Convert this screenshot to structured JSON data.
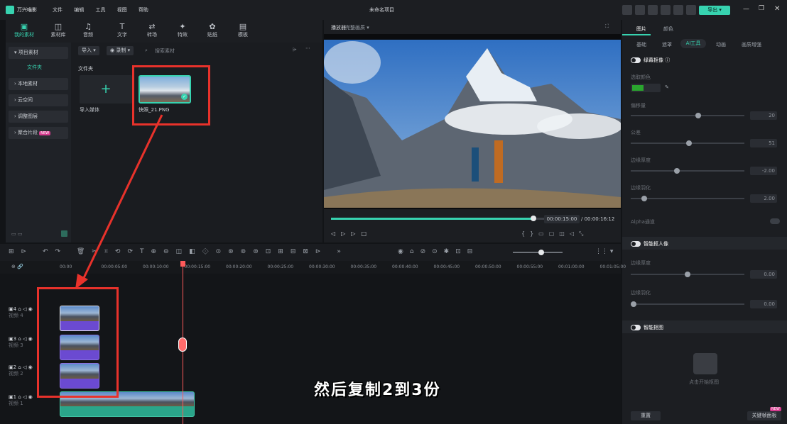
{
  "app": {
    "name": "万兴喵影",
    "project_title": "未命名项目",
    "export_label": "导出"
  },
  "menu": [
    "文件",
    "编辑",
    "工具",
    "视图",
    "帮助"
  ],
  "toolbar": [
    {
      "label": "我的素材",
      "icon": "media-icon"
    },
    {
      "label": "素材库",
      "icon": "stock-icon"
    },
    {
      "label": "音频",
      "icon": "music-icon"
    },
    {
      "label": "文字",
      "icon": "text-icon"
    },
    {
      "label": "转场",
      "icon": "transition-icon"
    },
    {
      "label": "特效",
      "icon": "effects-icon"
    },
    {
      "label": "贴纸",
      "icon": "sticker-icon"
    },
    {
      "label": "模板",
      "icon": "template-icon"
    }
  ],
  "sidebar": {
    "items": [
      "项目素材",
      "文件夹",
      "本地素材",
      "云空间",
      "调整图层",
      "聚合片段"
    ],
    "new_badge": "NEW"
  },
  "media": {
    "import_label": "导入",
    "record_label": "录制",
    "search_placeholder": "搜索素材",
    "folder_label": "文件夹",
    "import_media_label": "导入媒体",
    "file_name": "快照_21.PNG"
  },
  "preview": {
    "tab_player": "播放器",
    "quality": "完整画质",
    "time_current": "00:00:15:00",
    "time_total": "/ 00:00:16:12",
    "progress": 0.95
  },
  "right": {
    "tabs": [
      "图片",
      "颜色"
    ],
    "subtabs": [
      "基础",
      "遮罩",
      "AI工具",
      "动画",
      "画质增强"
    ],
    "section1": "绿幕抠像",
    "pick_color": "选取颜色",
    "params": [
      {
        "label": "偏移量",
        "value": "20",
        "level": 0.6
      },
      {
        "label": "公差",
        "value": "51",
        "level": 0.51
      },
      {
        "label": "边缘厚度",
        "value": "-2.00",
        "level": 0.4
      },
      {
        "label": "边缘羽化",
        "value": "2.00",
        "level": 0.1
      }
    ],
    "alpha_label": "Alpha通道",
    "section2": "智能抠人像",
    "params2": [
      {
        "label": "边缘厚度",
        "value": "0.00",
        "level": 0.5
      },
      {
        "label": "边缘羽化",
        "value": "0.00",
        "level": 0.0
      }
    ],
    "section3": "智能抠图",
    "smart_cutout_label": "点击开始抠图",
    "reset_label": "重置",
    "keyframe_label": "关键帧面板",
    "new_badge": "NEW"
  },
  "timeline": {
    "ruler": [
      "00:00",
      "00:00:05:00",
      "00:00:10:00",
      "00:00:15:00",
      "00:00:20:00",
      "00:00:25:00",
      "00:00:30:00",
      "00:00:35:00",
      "00:00:40:00",
      "00:00:45:00",
      "00:00:50:00",
      "00:00:55:00",
      "00:01:00:00",
      "00:01:05:00"
    ],
    "tracks": [
      {
        "num": "4",
        "label": "视频 4"
      },
      {
        "num": "3",
        "label": "视频 3"
      },
      {
        "num": "2",
        "label": "视频 2"
      },
      {
        "num": "1",
        "label": "视频 1"
      }
    ]
  },
  "subtitle": "然后复制2到3份",
  "colors": {
    "accent": "#37d3b0",
    "annotation": "#e8322b",
    "clip_purple": "#6b4ad1",
    "clip_teal": "#2aa58a"
  }
}
